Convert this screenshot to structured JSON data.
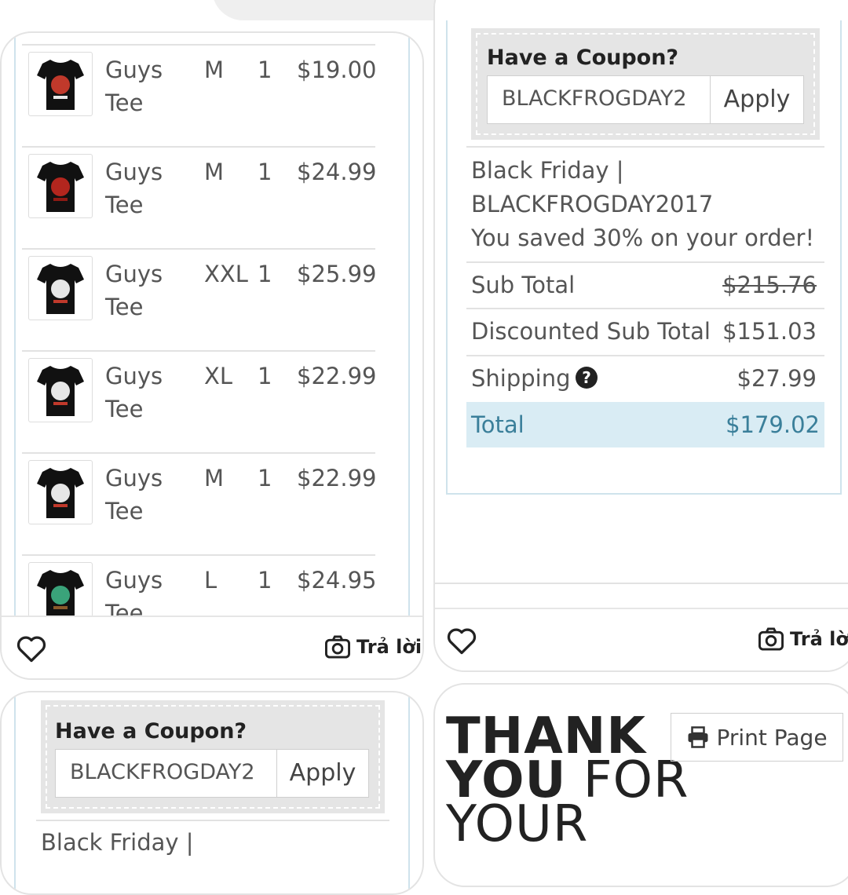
{
  "colors": {
    "total_bg": "#d9ecf4",
    "total_text": "#3a7f9a",
    "card_border": "#e3e3e3",
    "accent_rule": "#cfe3ec"
  },
  "left_card": {
    "items": [
      {
        "name": "Guys Tee",
        "size": "M",
        "qty": "1",
        "price": "$19.00",
        "shirt_print": "red-text"
      },
      {
        "name": "Guys Tee",
        "size": "M",
        "qty": "1",
        "price": "$24.99",
        "shirt_print": "red-circle"
      },
      {
        "name": "Guys Tee",
        "size": "XXL",
        "qty": "1",
        "price": "$25.99",
        "shirt_print": "white-red"
      },
      {
        "name": "Guys Tee",
        "size": "XL",
        "qty": "1",
        "price": "$22.99",
        "shirt_print": "white-red"
      },
      {
        "name": "Guys Tee",
        "size": "M",
        "qty": "1",
        "price": "$22.99",
        "shirt_print": "white-red"
      },
      {
        "name": "Guys Tee",
        "size": "L",
        "qty": "1",
        "price": "$24.95",
        "shirt_print": "green"
      }
    ],
    "reply_label": "Trả lời"
  },
  "bottom_left_card": {
    "coupon_title": "Have a Coupon?",
    "coupon_value": "BLACKFROGDAY2",
    "apply_label": "Apply",
    "cut_text": "Black Friday |"
  },
  "right_card": {
    "coupon_title": "Have a Coupon?",
    "coupon_value": "BLACKFROGDAY2",
    "apply_label": "Apply",
    "promo_line1": "Black Friday |",
    "promo_line2": "BLACKFROGDAY2017",
    "promo_line3": "You saved 30% on your order!",
    "subtotal_label": "Sub Total",
    "subtotal_value": "$215.76",
    "discounted_label": "Discounted Sub Total",
    "discounted_value": "$151.03",
    "shipping_label": "Shipping",
    "shipping_value": "$27.99",
    "total_label": "Total",
    "total_value": "$179.02",
    "reply_label": "Trả lời"
  },
  "bottom_right_card": {
    "thank_word1": "THANK",
    "thank_word2": "YOU",
    "thank_word3": "FOR",
    "thank_word4": "YOUR",
    "print_label": "Print Page"
  }
}
